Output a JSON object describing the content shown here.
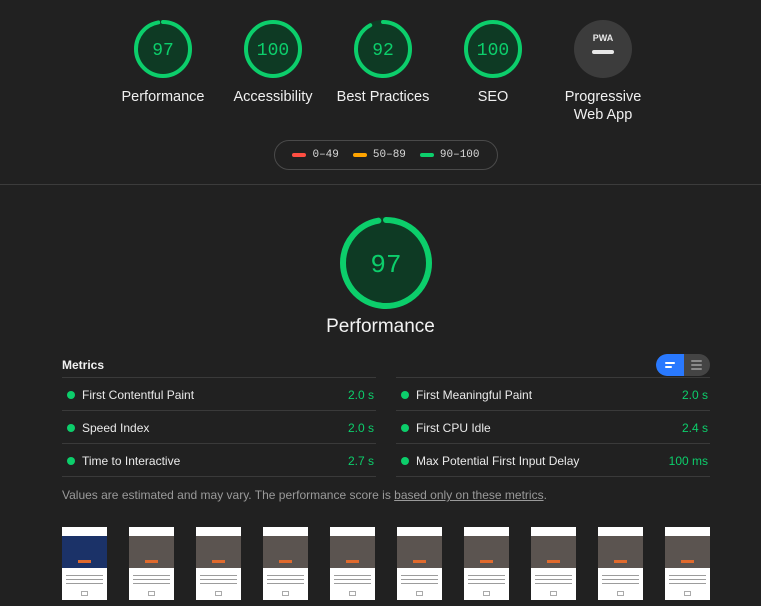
{
  "colors": {
    "pass": "#0cce6b",
    "average": "#ffa400",
    "fail": "#ff4e42",
    "pass_fill": "#0e3a24",
    "pwa_gray": "#3c3c3c"
  },
  "categories": [
    {
      "score": "97",
      "label": "Performance",
      "fraction": 0.97
    },
    {
      "score": "100",
      "label": "Accessibility",
      "fraction": 1.0
    },
    {
      "score": "92",
      "label": "Best Practices",
      "fraction": 0.92
    },
    {
      "score": "100",
      "label": "SEO",
      "fraction": 1.0
    }
  ],
  "pwa": {
    "badge": "PWA",
    "label_line1": "Progressive",
    "label_line2": "Web App"
  },
  "legend": [
    {
      "range": "0–49",
      "color": "#ff4e42"
    },
    {
      "range": "50–89",
      "color": "#ffa400"
    },
    {
      "range": "90–100",
      "color": "#0cce6b"
    }
  ],
  "performance": {
    "score": "97",
    "title": "Performance",
    "fraction": 0.97
  },
  "metrics": {
    "title": "Metrics",
    "items": [
      {
        "label": "First Contentful Paint",
        "value": "2.0 s"
      },
      {
        "label": "First Meaningful Paint",
        "value": "2.0 s"
      },
      {
        "label": "Speed Index",
        "value": "2.0 s"
      },
      {
        "label": "First CPU Idle",
        "value": "2.4 s"
      },
      {
        "label": "Time to Interactive",
        "value": "2.7 s"
      },
      {
        "label": "Max Potential First Input Delay",
        "value": "100 ms"
      }
    ]
  },
  "footnote": {
    "text": "Values are estimated and may vary. The performance score is ",
    "link": "based only on these metrics",
    "end": "."
  },
  "filmstrip": {
    "frame_count": 10
  }
}
